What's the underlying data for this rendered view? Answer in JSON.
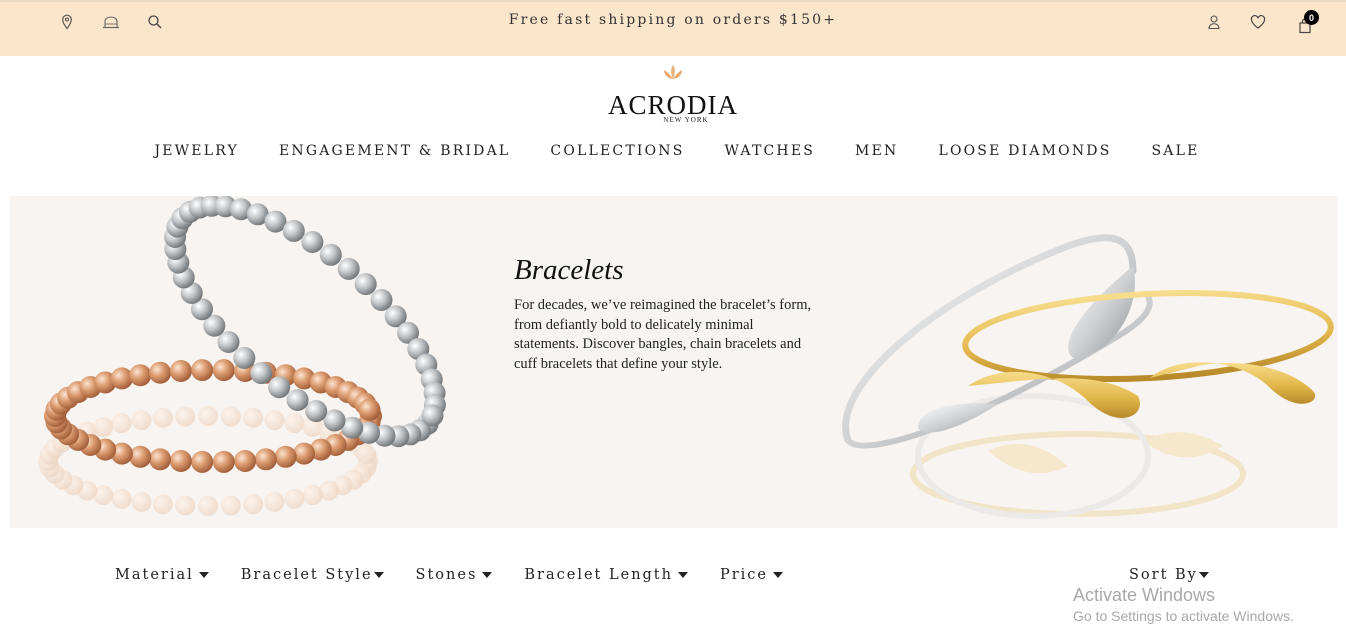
{
  "topbar": {
    "promo_text": "Free fast shipping on orders  $150+",
    "cart_count": "0",
    "left_icons": [
      "location-icon",
      "store-icon",
      "search-icon"
    ],
    "right_icons": [
      "account-icon",
      "wishlist-icon",
      "cart-icon"
    ]
  },
  "logo": {
    "name": "ACRODIA",
    "subtitle": "NEW YORK"
  },
  "nav": {
    "items": [
      "JEWELRY",
      "ENGAGEMENT & BRIDAL",
      "COLLECTIONS",
      "WATCHES",
      "MEN",
      "LOOSE DIAMONDS",
      "SALE"
    ]
  },
  "hero": {
    "title": "Bracelets",
    "description": "For decades, we’ve reimagined the bracelet’s form, from defiantly bold to delicately minimal statements. Discover bangles, chain bracelets and cuff bracelets that define your style."
  },
  "filters": {
    "items": [
      "Material",
      "Bracelet Style",
      "Stones",
      "Bracelet Length",
      "Price"
    ],
    "sort_label": "Sort By"
  },
  "watermark": {
    "title": "Activate Windows",
    "subtitle": "Go to Settings to activate Windows."
  },
  "colors": {
    "topbar_bg": "#fce6cb",
    "hero_bg": "#f8f4f1",
    "logo_accent": "#e9b07a",
    "gold": "#e8c055",
    "rose_gold": "#d9956a",
    "silver": "#c9cbcd"
  }
}
